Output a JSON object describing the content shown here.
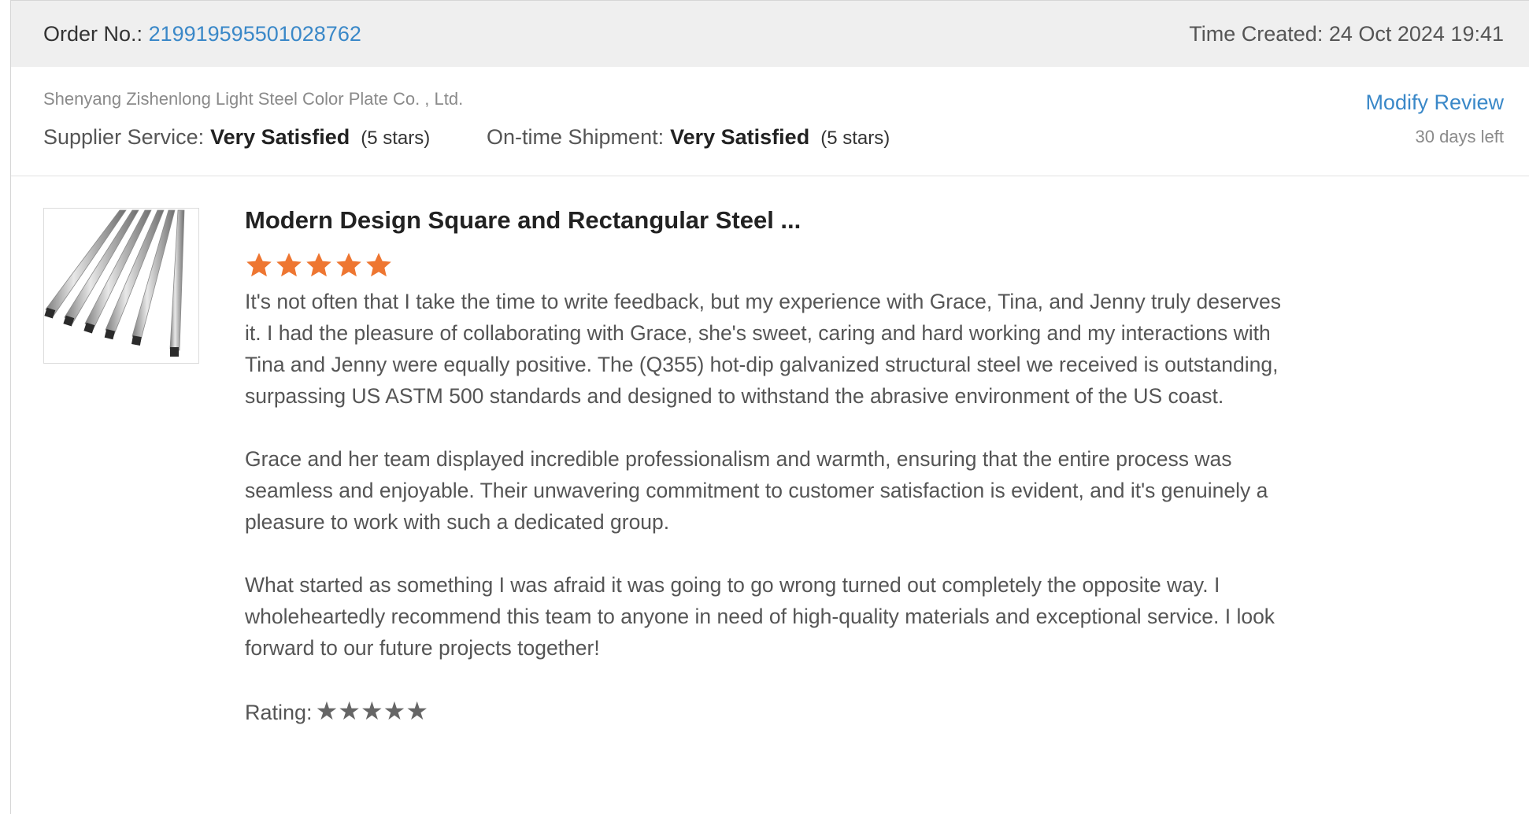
{
  "order": {
    "label": "Order No.:",
    "number": "219919595501028762",
    "time_created": "Time Created: 24 Oct 2024 19:41"
  },
  "supplier": {
    "name": "Shenyang Zishenlong Light Steel Color Plate Co. , Ltd.",
    "service_label": "Supplier Service:",
    "service_value": "Very Satisfied",
    "service_stars": "(5 stars)",
    "shipment_label": "On-time Shipment:",
    "shipment_value": "Very Satisfied",
    "shipment_stars": "(5 stars)",
    "modify_review": "Modify Review",
    "days_left": "30 days left"
  },
  "product": {
    "title": "Modern Design Square and Rectangular Steel ...",
    "star_rating": 5,
    "star_max": 5,
    "image_icon": "steel-tubes-image"
  },
  "review": {
    "paragraphs": [
      "It's not often that I take the time to write feedback, but my experience with Grace, Tina, and Jenny truly deserves it. I had the pleasure of collaborating with Grace, she's sweet, caring and hard working and my interactions with Tina and Jenny were equally positive. The (Q355) hot-dip galvanized structural steel we received is outstanding, surpassing US ASTM 500 standards and designed to withstand the abrasive environment of the US coast.",
      "Grace and her team displayed incredible professionalism and warmth, ensuring that the entire process was seamless and enjoyable. Their unwavering commitment to customer satisfaction is evident, and it's genuinely a pleasure to work with such a dedicated group.",
      "What started as something I was afraid it was going to go wrong turned out completely the opposite way. I wholeheartedly recommend this team to anyone in need of high-quality materials and exceptional service. I look forward to our future projects together!"
    ],
    "rating_label": "Rating:",
    "rating_stars": "★★★★★"
  },
  "colors": {
    "accent_link": "#3a88c8",
    "star_orange": "#ee7631",
    "header_bg": "#efefef"
  }
}
